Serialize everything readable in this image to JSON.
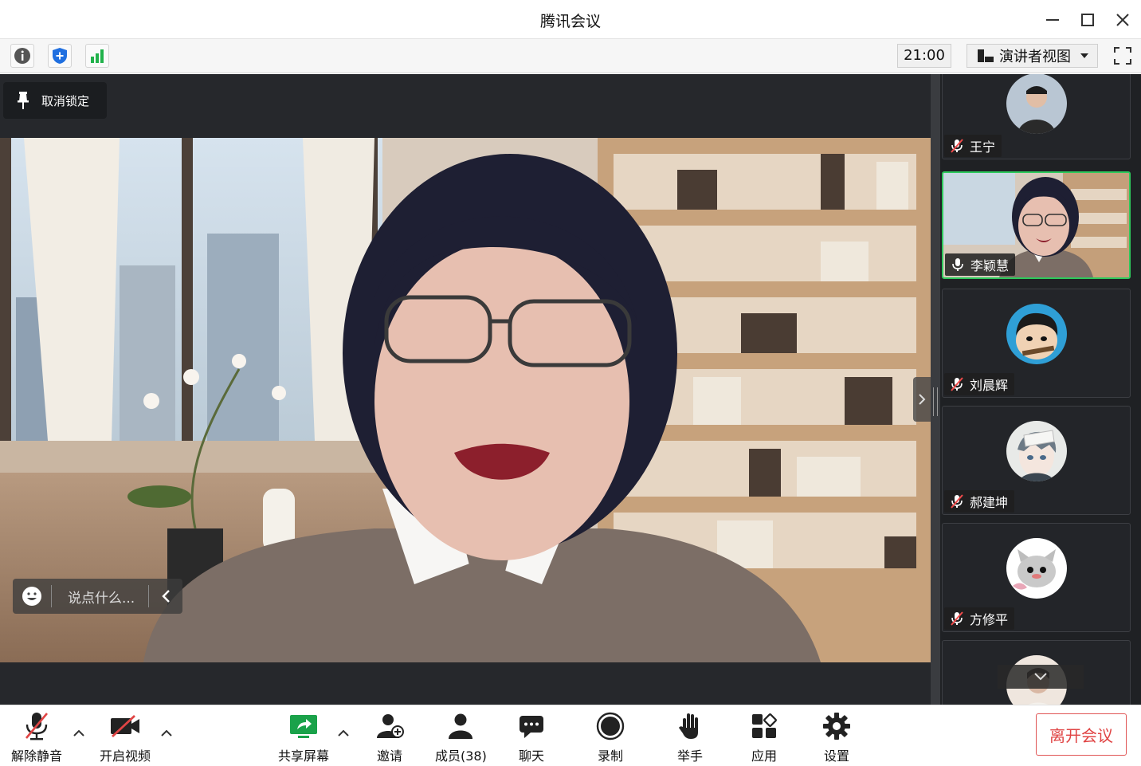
{
  "window": {
    "title": "腾讯会议"
  },
  "toolbar": {
    "timer": "21:00",
    "view_mode": "演讲者视图"
  },
  "main": {
    "unlock_label": "取消锁定",
    "chat_placeholder": "说点什么..."
  },
  "participants": [
    {
      "name": "王宁",
      "muted": true
    },
    {
      "name": "李颖慧",
      "muted": false,
      "speaking": true
    },
    {
      "name": "刘晨辉",
      "muted": true
    },
    {
      "name": "郝建坤",
      "muted": true
    },
    {
      "name": "方修平",
      "muted": true
    }
  ],
  "bottom": {
    "unmute": "解除静音",
    "start_video": "开启视频",
    "share_screen": "共享屏幕",
    "invite": "邀请",
    "members": "成员(38)",
    "chat": "聊天",
    "record": "录制",
    "raise_hand": "举手",
    "apps": "应用",
    "settings": "设置",
    "leave": "离开会议"
  },
  "colors": {
    "accent_green": "#2ec95c",
    "leave_red": "#e04444",
    "panel_dark": "#1f2124"
  }
}
